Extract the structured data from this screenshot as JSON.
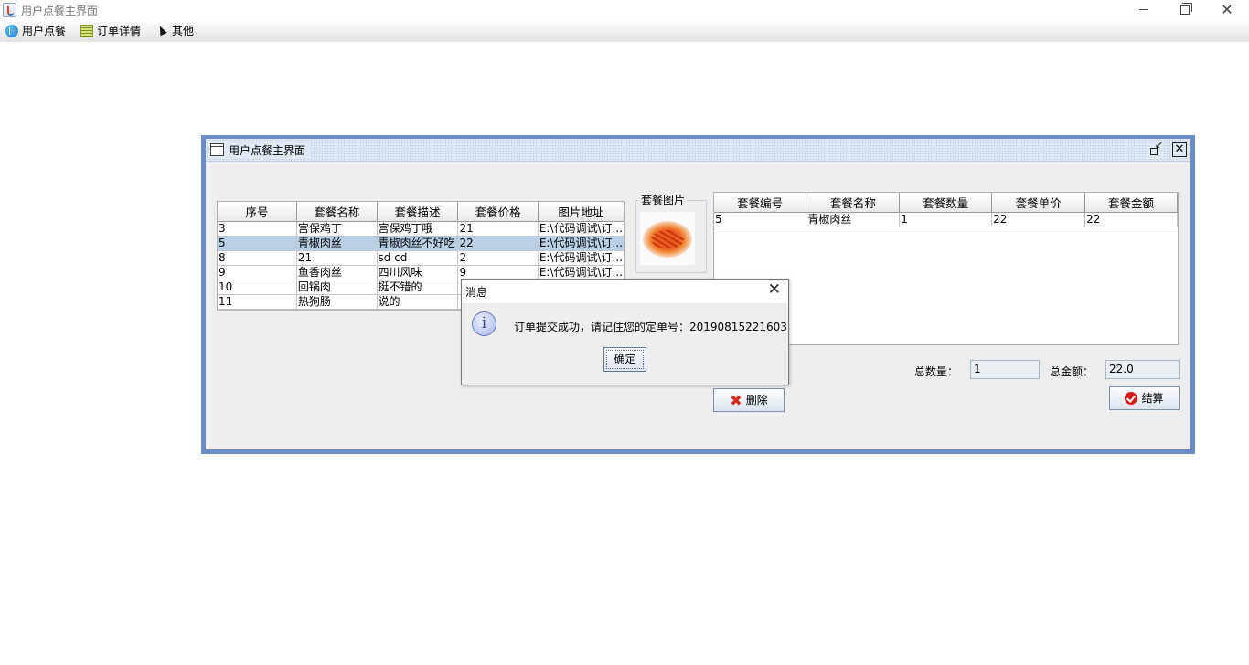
{
  "window": {
    "title": "用户点餐主界面"
  },
  "menu": [
    {
      "label": "用户点餐",
      "icon": "food-icon"
    },
    {
      "label": "订单详情",
      "icon": "calculator-icon"
    },
    {
      "label": "其他",
      "icon": "pointer-icon"
    }
  ],
  "frame": {
    "title": "用户点餐主界面"
  },
  "left_table": {
    "headers": [
      "序号",
      "套餐名称",
      "套餐描述",
      "套餐价格",
      "图片地址"
    ],
    "rows": [
      [
        "3",
        "宫保鸡丁",
        "宫保鸡丁哦",
        "21",
        "E:\\代码调试\\订..."
      ],
      [
        "5",
        "青椒肉丝",
        "青椒肉丝不好吃",
        "22",
        "E:\\代码调试\\订..."
      ],
      [
        "8",
        "21",
        "sd cd",
        "2",
        "E:\\代码调试\\订..."
      ],
      [
        "9",
        "鱼香肉丝",
        "四川风味",
        "9",
        "E:\\代码调试\\订..."
      ],
      [
        "10",
        "回锅肉",
        "挺不错的",
        "",
        ""
      ],
      [
        "11",
        "热狗肠",
        "说的",
        "",
        ""
      ]
    ],
    "selected_row": 1
  },
  "image_panel": {
    "label": "套餐图片",
    "image": "shredded-pepper-pork"
  },
  "right_table": {
    "headers": [
      "套餐编号",
      "套餐名称",
      "套餐数量",
      "套餐单价",
      "套餐金额"
    ],
    "rows": [
      [
        "5",
        "青椒肉丝",
        "1",
        "22",
        "22"
      ]
    ]
  },
  "totals": {
    "qty_label": "总数量：",
    "qty_value": "1",
    "amount_label": "总金额：",
    "amount_value": "22.0"
  },
  "buttons": {
    "delete": "删除",
    "checkout": "结算"
  },
  "dialog": {
    "title": "消息",
    "message": "订单提交成功，请记住您的定单号：20190815221603",
    "ok": "确定"
  }
}
